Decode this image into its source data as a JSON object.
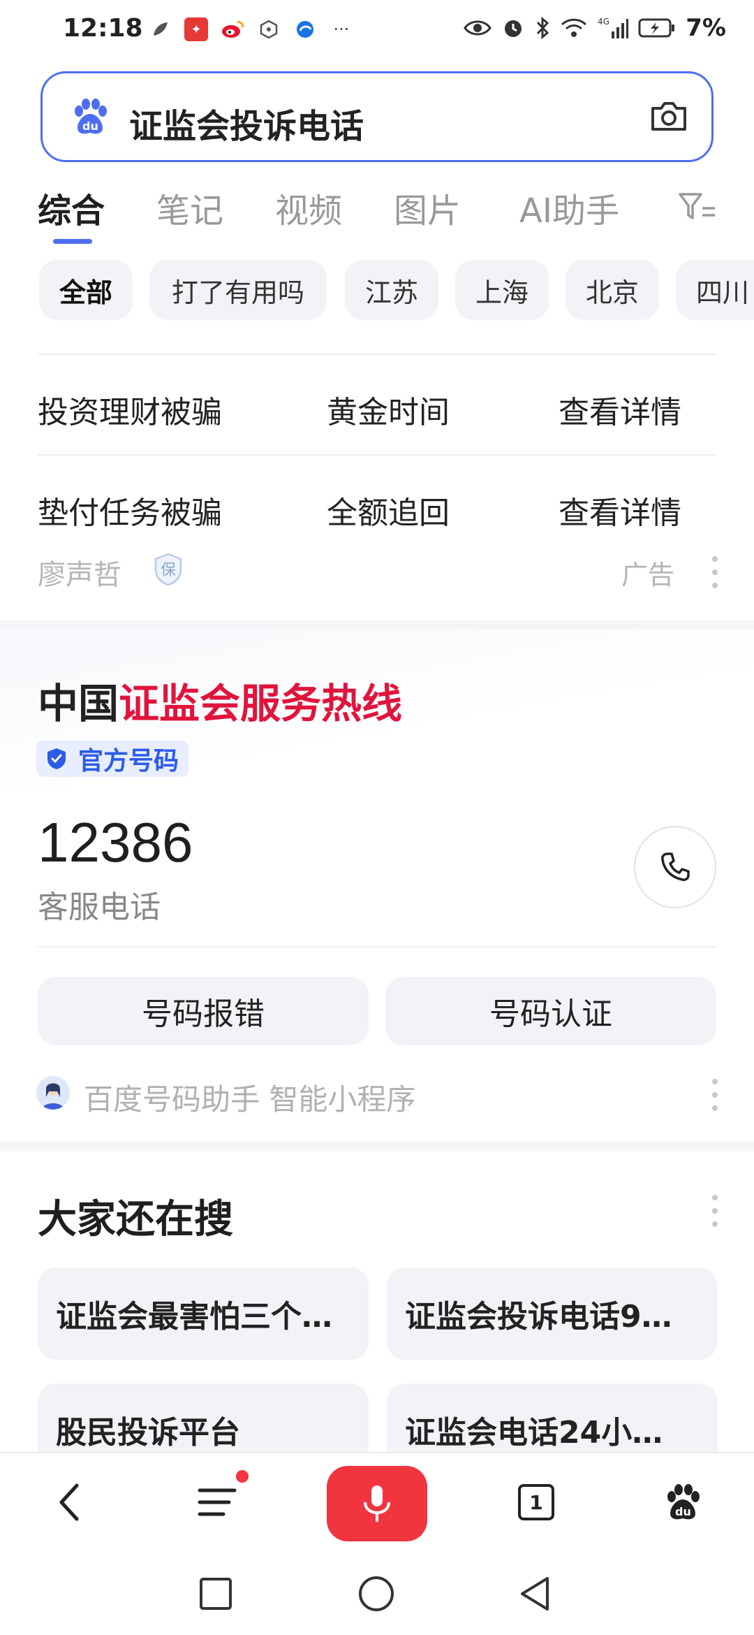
{
  "status_bar": {
    "time": "12:18",
    "battery": "7%",
    "network": "4G"
  },
  "search": {
    "query": "证监会投诉电话"
  },
  "tabs": [
    {
      "label": "综合",
      "active": true
    },
    {
      "label": "笔记"
    },
    {
      "label": "视频"
    },
    {
      "label": "图片"
    },
    {
      "label": "AI助手"
    }
  ],
  "chips": [
    {
      "label": "全部",
      "active": true
    },
    {
      "label": "打了有用吗"
    },
    {
      "label": "江苏"
    },
    {
      "label": "上海"
    },
    {
      "label": "北京"
    },
    {
      "label": "四川"
    }
  ],
  "ad": {
    "rows": [
      {
        "col1": "投资理财被骗",
        "col2": "黄金时间",
        "col3": "查看详情"
      },
      {
        "col1": "垫付任务被骗",
        "col2": "全额追回",
        "col3": "查看详情"
      }
    ],
    "source": "廖声哲",
    "badge": "保",
    "label": "广告"
  },
  "hotline": {
    "title_prefix": "中国",
    "title_highlight": "证监会服务热线",
    "badge": "官方号码",
    "number": "12386",
    "number_label": "客服电话",
    "actions": [
      "号码报错",
      "号码认证"
    ],
    "assistant": "百度号码助手 智能小程序"
  },
  "also_search": {
    "title": "大家还在搜",
    "items": [
      "证监会最害怕三个…",
      "证监会投诉电话9…",
      "股民投诉平台",
      "证监会电话24小…"
    ]
  },
  "toolbar": {
    "tab_count": "1"
  },
  "colors": {
    "accent": "#4e6ef2",
    "highlight_red": "#e0143c",
    "mic_red": "#f0353f"
  }
}
